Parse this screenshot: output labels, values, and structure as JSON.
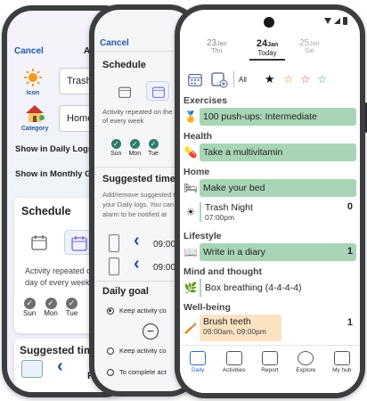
{
  "back_phone": {
    "cancel": "Cancel",
    "title_fragment": "A",
    "icon_label": "Icon",
    "category_label": "Category",
    "name_value": "Trash",
    "category_value": "Home",
    "show_daily": "Show in Daily Logs",
    "show_monthly": "Show in Monthly G",
    "schedule_title": "Schedule",
    "schedule_text": "Activity repeated on the day of every week",
    "days": [
      "Sun",
      "Mon",
      "Tue"
    ],
    "suggested_title": "Suggested tim",
    "time_fragment": "PM"
  },
  "middle_phone": {
    "cancel": "Cancel",
    "schedule_title": "Schedule",
    "schedule_text": "Activity repeated on the day of every week",
    "days": [
      "Sun",
      "Mon",
      "Tue"
    ],
    "suggested_title": "Suggested time",
    "suggested_text": "Add/remove suggested time to your Daily logs. You can set an alarm to be notified at",
    "time1": "09:00",
    "time2": "09:00",
    "goal_title": "Daily goal",
    "goal_opt1": "Keep activity co",
    "goal_opt2": "Keep activity co",
    "goal_opt3": "To complete act"
  },
  "front_phone": {
    "dates": [
      {
        "num": "23",
        "mon": "Jan",
        "day": "Thu"
      },
      {
        "num": "24",
        "mon": "Jan",
        "day": "Today"
      },
      {
        "num": "25",
        "mon": "Jan",
        "day": "Sat"
      }
    ],
    "filter_all": "All",
    "categories": [
      {
        "name": "Exercises",
        "tasks": [
          {
            "title": "100 push-ups: Intermediate",
            "icon": "trophy-icon",
            "count": "",
            "color": "#a8d5b5"
          }
        ]
      },
      {
        "name": "Health",
        "tasks": [
          {
            "title": "Take a multivitamin",
            "icon": "pill-icon",
            "count": "",
            "color": "#a8d5b5"
          }
        ]
      },
      {
        "name": "Home",
        "tasks": [
          {
            "title": "Make your bed",
            "icon": "bed-icon",
            "count": "",
            "color": "#a8d5b5"
          },
          {
            "title": "Trash Night",
            "sub": "07:00pm",
            "icon": "sun-icon",
            "count": "0",
            "color": "#ffffff"
          }
        ]
      },
      {
        "name": "Lifestyle",
        "tasks": [
          {
            "title": "Write in a diary",
            "icon": "book-icon",
            "count": "1",
            "color": "#a8d5b5"
          }
        ]
      },
      {
        "name": "Mind and thought",
        "tasks": [
          {
            "title": "Box breathing (4-4-4-4)",
            "icon": "lotus-icon",
            "count": "",
            "color": "#ffffff"
          }
        ]
      },
      {
        "name": "Well-being",
        "tasks": [
          {
            "title": "Brush teeth",
            "sub": "09:00am, 09:00pm",
            "icon": "toothbrush-icon",
            "count": "1",
            "color": "#fbe3c2"
          }
        ]
      }
    ],
    "nav": [
      "Daily",
      "Activities",
      "Report",
      "Explore",
      "My hub"
    ]
  }
}
